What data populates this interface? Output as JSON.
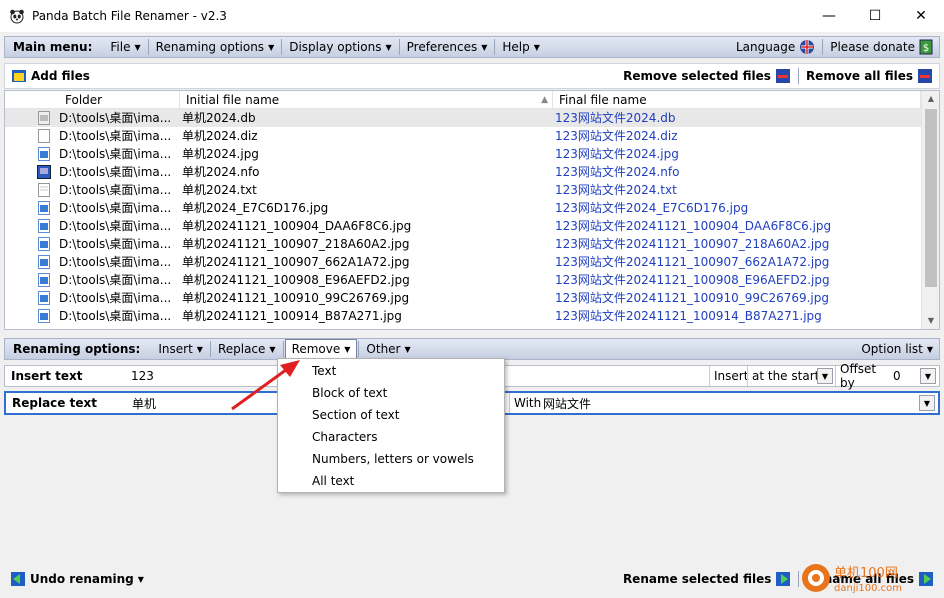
{
  "window": {
    "title": "Panda Batch File Renamer - v2.3",
    "minimize": "—",
    "maximize": "☐",
    "close": "✕"
  },
  "main_menu": {
    "label": "Main menu:",
    "items": [
      "File",
      "Renaming options",
      "Display options",
      "Preferences",
      "Help"
    ],
    "language": "Language",
    "donate": "Please donate"
  },
  "top_toolbar": {
    "add_files": "Add files",
    "remove_selected": "Remove selected files",
    "remove_all": "Remove all files"
  },
  "table": {
    "columns": [
      "Folder",
      "Initial file name",
      "Final file name"
    ],
    "rows": [
      {
        "folder": "D:\\tools\\桌面\\ima...",
        "initial": "单机2024.db",
        "final": "123网站文件2024.db",
        "icon": "db-file-icon"
      },
      {
        "folder": "D:\\tools\\桌面\\ima...",
        "initial": "单机2024.diz",
        "final": "123网站文件2024.diz",
        "icon": "file-icon"
      },
      {
        "folder": "D:\\tools\\桌面\\ima...",
        "initial": "单机2024.jpg",
        "final": "123网站文件2024.jpg",
        "icon": "image-file-icon"
      },
      {
        "folder": "D:\\tools\\桌面\\ima...",
        "initial": "单机2024.nfo",
        "final": "123网站文件2024.nfo",
        "icon": "nfo-file-icon"
      },
      {
        "folder": "D:\\tools\\桌面\\ima...",
        "initial": "单机2024.txt",
        "final": "123网站文件2024.txt",
        "icon": "text-file-icon"
      },
      {
        "folder": "D:\\tools\\桌面\\ima...",
        "initial": "单机2024_E7C6D176.jpg",
        "final": "123网站文件2024_E7C6D176.jpg",
        "icon": "image-file-icon"
      },
      {
        "folder": "D:\\tools\\桌面\\ima...",
        "initial": "单机20241121_100904_DAA6F8C6.jpg",
        "final": "123网站文件20241121_100904_DAA6F8C6.jpg",
        "icon": "image-file-icon"
      },
      {
        "folder": "D:\\tools\\桌面\\ima...",
        "initial": "单机20241121_100907_218A60A2.jpg",
        "final": "123网站文件20241121_100907_218A60A2.jpg",
        "icon": "image-file-icon"
      },
      {
        "folder": "D:\\tools\\桌面\\ima...",
        "initial": "单机20241121_100907_662A1A72.jpg",
        "final": "123网站文件20241121_100907_662A1A72.jpg",
        "icon": "image-file-icon"
      },
      {
        "folder": "D:\\tools\\桌面\\ima...",
        "initial": "单机20241121_100908_E96AEFD2.jpg",
        "final": "123网站文件20241121_100908_E96AEFD2.jpg",
        "icon": "image-file-icon"
      },
      {
        "folder": "D:\\tools\\桌面\\ima...",
        "initial": "单机20241121_100910_99C26769.jpg",
        "final": "123网站文件20241121_100910_99C26769.jpg",
        "icon": "image-file-icon"
      },
      {
        "folder": "D:\\tools\\桌面\\ima...",
        "initial": "单机20241121_100914_B87A271.jpg",
        "final": "123网站文件20241121_100914_B87A271.jpg",
        "icon": "image-file-icon"
      }
    ]
  },
  "renaming_bar": {
    "label": "Renaming options:",
    "items": [
      "Insert",
      "Replace",
      "Remove",
      "Other"
    ],
    "active": "Remove",
    "option_list": "Option list"
  },
  "insert_row": {
    "label": "Insert text",
    "value": "123",
    "insert_label": "Insert",
    "position": "at the start",
    "offset_label": "Offset by",
    "offset_value": "0"
  },
  "replace_row": {
    "label": "Replace text",
    "value": "单机",
    "with_label": "With",
    "with_value": "网站文件"
  },
  "remove_menu": {
    "items": [
      "Text",
      "Block of text",
      "Section of text",
      "Characters",
      "Numbers, letters or vowels",
      "All text"
    ]
  },
  "bottom_toolbar": {
    "undo": "Undo renaming",
    "rename_selected": "Rename selected files",
    "rename_all": "Rename all files"
  },
  "watermark": {
    "cn": "单机100网",
    "url": "danji100.com"
  },
  "colors": {
    "final_name": "#1f3fc0",
    "bar_bg": "#c6cfe2",
    "arrow": "#e02020",
    "focus_border": "#2f6fd0"
  }
}
